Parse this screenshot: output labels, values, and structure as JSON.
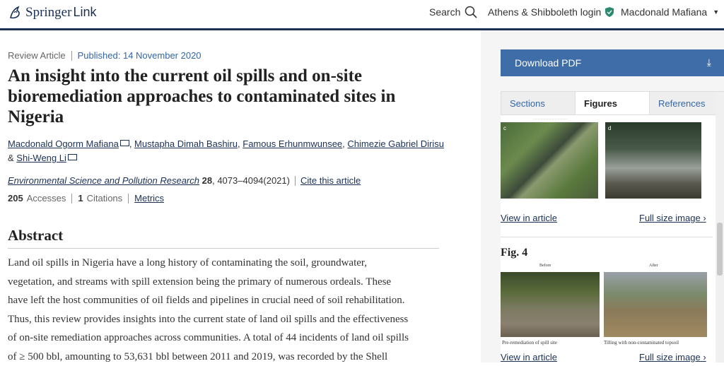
{
  "brand": {
    "springer": "Springer",
    "link": "Link"
  },
  "nav": {
    "search": "Search",
    "login": "Athens & Shibboleth login",
    "user": "Macdonald Mafiana"
  },
  "article": {
    "type": "Review Article",
    "published": "Published: 14 November 2020",
    "title": "An insight into the current oil spills and on-site bioremediation approaches to contaminated sites in Nigeria",
    "authors": [
      "Macdonald Ogorm Mafiana",
      "Mustapha Dimah Bashiru",
      "Famous Erhunmwunsee",
      "Chimezie Gabriel Dirisu",
      "Shi-Weng Li"
    ],
    "and": "&",
    "journal": "Environmental Science and Pollution Research",
    "volume": "28",
    "pages": "4073–4094(2021)",
    "cite": "Cite this article",
    "accesses_count": "205",
    "accesses_label": "Accesses",
    "citations_count": "1",
    "citations_label": "Citations",
    "metrics": "Metrics",
    "abstract_heading": "Abstract",
    "abstract_lines": [
      "Land oil spills in Nigeria have a long history of contaminating the soil, groundwater,",
      "vegetation, and streams with spill extension being the primary of numerous ordeals. These",
      "have left the host communities of oil fields and pipelines in crucial need of soil rehabilitation.",
      "Thus, this review provides insights into the current state of land oil spills and the effectiveness",
      "of on-site remediation approaches across communities. A total of 44 incidents of land oil spills",
      "of ≥ 500 bbl, amounting to 53,631 bbl between 2011 and 2019, was recorded by the Shell"
    ]
  },
  "sidebar": {
    "download": "Download PDF",
    "tabs": [
      "Sections",
      "Figures",
      "References"
    ],
    "view_in_article": "View in article",
    "full_size": "Full size image",
    "fig4_title": "Fig. 4",
    "fig4_labels": {
      "before": "Before",
      "after": "After"
    },
    "fig4_captions": {
      "left": "Pre-remediation of spill site",
      "right": "Tilling with non-contaminated topsoil"
    },
    "fig3_panel_labels": {
      "c": "c",
      "d": "d"
    }
  },
  "colors": {
    "navy": "#1a3055",
    "accent": "#3e6da8",
    "link": "#3366a8"
  }
}
